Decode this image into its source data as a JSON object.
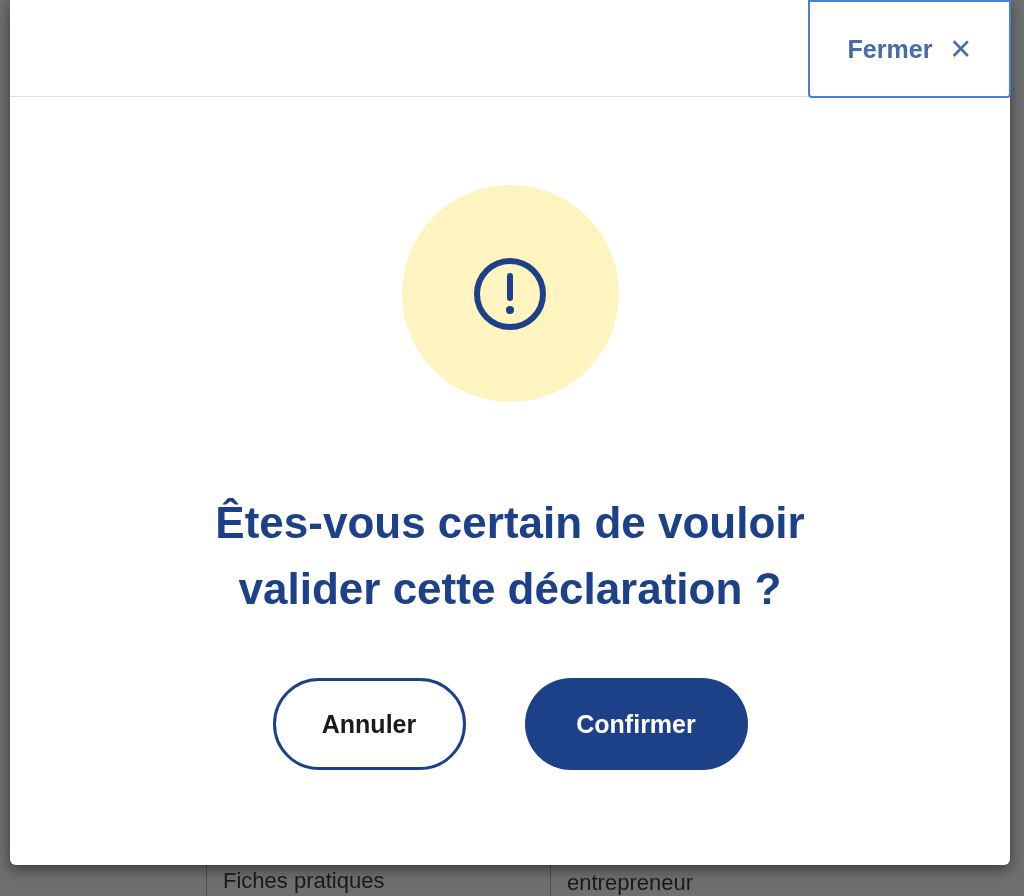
{
  "background": {
    "cells": [
      "Fiches pratiques",
      "entrepreneur"
    ]
  },
  "dialog": {
    "close_button": {
      "label": "Fermer",
      "icon": "×"
    },
    "title": "Êtes-vous certain de vouloir valider cette déclaration ?",
    "buttons": [
      {
        "label": "Annuler",
        "kind": "secondary"
      },
      {
        "label": "Confirmer",
        "kind": "primary"
      }
    ]
  }
}
